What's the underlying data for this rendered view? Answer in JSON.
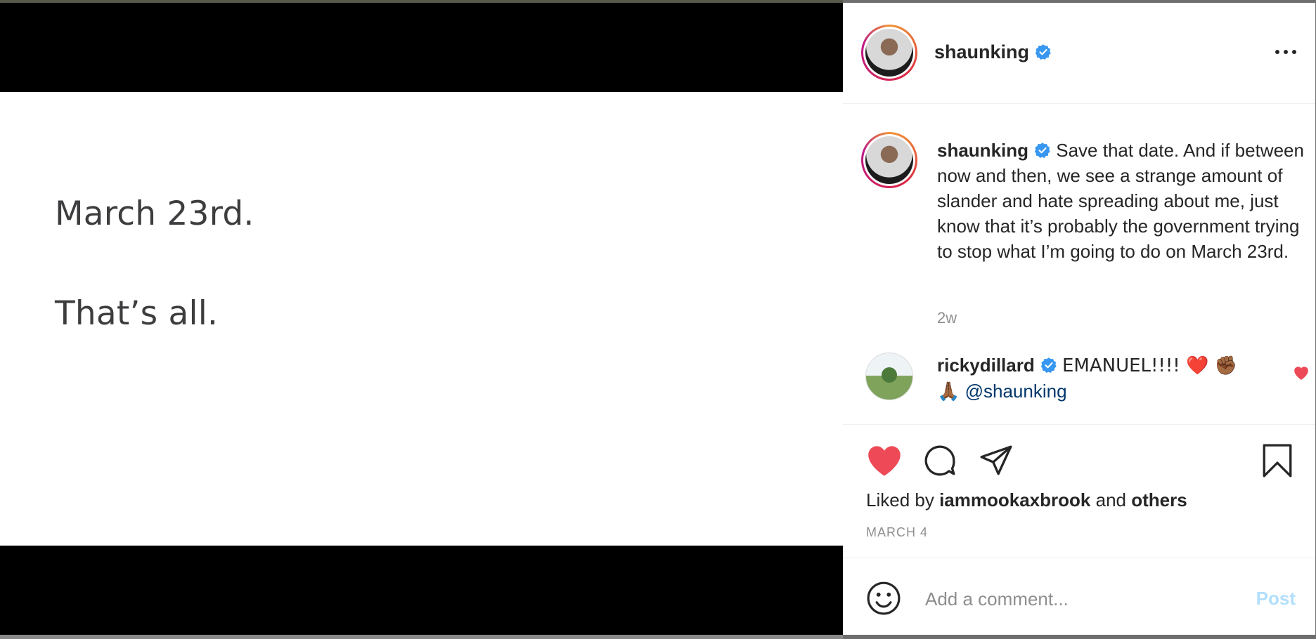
{
  "media": {
    "line1": "March 23rd.",
    "line2": "That’s all."
  },
  "post": {
    "username": "shaunking",
    "verified": true
  },
  "caption": {
    "username": "shaunking",
    "text": "Save that date. And if between now and then, we see a strange amount of slander and hate spreading about me, just know that it’s probably the government trying to stop what I’m going to do on March 23rd.",
    "time": "2w"
  },
  "comments": [
    {
      "username": "rickydillard",
      "text": "EMANUEL!!!! ❤️ ✊🏾 🙏🏾",
      "mention": "@shaunking"
    }
  ],
  "likes": {
    "prefix": "Liked by",
    "user": "iammookaxbrook",
    "middle": "and",
    "suffix": "others"
  },
  "date": "MARCH 4",
  "add_comment": {
    "placeholder": "Add a comment...",
    "post_label": "Post"
  },
  "colors": {
    "heart": "#ed4956",
    "verified": "#3897f0",
    "link": "#00376b",
    "post_disabled": "#b2dffc"
  },
  "icons": [
    "more-icon",
    "verified-icon",
    "heart-icon",
    "comment-icon",
    "share-icon",
    "bookmark-icon",
    "emoji-icon"
  ]
}
